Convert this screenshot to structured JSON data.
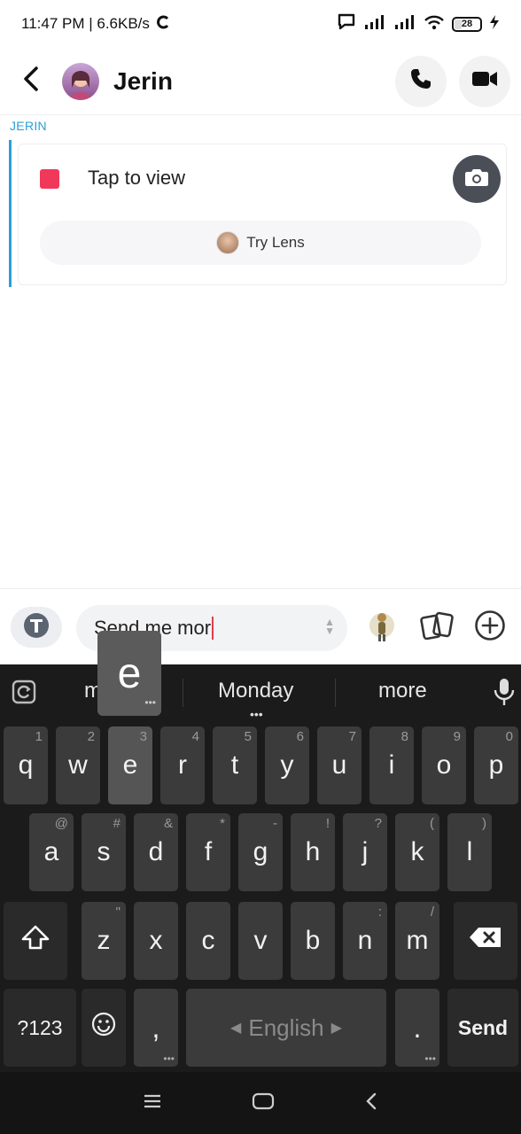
{
  "status_bar": {
    "time_speed": "11:47 PM | 6.6KB/s",
    "battery": "28"
  },
  "header": {
    "contact_name": "Jerin"
  },
  "chat": {
    "sender_label": "JERIN",
    "message_text": "Tap to view",
    "lens_label": "Try Lens"
  },
  "composer": {
    "text": "Send me mor"
  },
  "keyboard": {
    "suggestions": [
      "m",
      "Monday",
      "more"
    ],
    "popup_char": "e",
    "row1": [
      {
        "k": "q",
        "h": "1"
      },
      {
        "k": "w",
        "h": "2"
      },
      {
        "k": "e",
        "h": "3"
      },
      {
        "k": "r",
        "h": "4"
      },
      {
        "k": "t",
        "h": "5"
      },
      {
        "k": "y",
        "h": "6"
      },
      {
        "k": "u",
        "h": "7"
      },
      {
        "k": "i",
        "h": "8"
      },
      {
        "k": "o",
        "h": "9"
      },
      {
        "k": "p",
        "h": "0"
      }
    ],
    "row2": [
      {
        "k": "a",
        "h": "@"
      },
      {
        "k": "s",
        "h": "#"
      },
      {
        "k": "d",
        "h": "&"
      },
      {
        "k": "f",
        "h": "*"
      },
      {
        "k": "g",
        "h": "-"
      },
      {
        "k": "h",
        "h": "!"
      },
      {
        "k": "j",
        "h": "?"
      },
      {
        "k": "k",
        "h": "("
      },
      {
        "k": "l",
        "h": ")"
      }
    ],
    "row3": [
      {
        "k": "z",
        "h": "\""
      },
      {
        "k": "x",
        "h": ""
      },
      {
        "k": "c",
        "h": ""
      },
      {
        "k": "v",
        "h": ""
      },
      {
        "k": "b",
        "h": ""
      },
      {
        "k": "n",
        "h": ":"
      },
      {
        "k": "m",
        "h": "/"
      }
    ],
    "symbols_label": "?123",
    "comma": ",",
    "space_label": "English",
    "period": ".",
    "send_label": "Send"
  },
  "colors": {
    "accent_blue": "#2a9fd8",
    "snap_red": "#f2385a",
    "keyboard_bg": "#1b1b1b",
    "key_bg": "#3b3b3b"
  },
  "icons": [
    "back-icon",
    "phone-icon",
    "video-icon",
    "camera-icon",
    "text-format-icon",
    "bitmoji-icon",
    "cards-icon",
    "plus-icon",
    "clipboard-sync-icon",
    "mic-icon",
    "shift-icon",
    "backspace-icon",
    "emoji-icon",
    "nav-menu-icon",
    "nav-home-icon",
    "nav-back-icon"
  ]
}
